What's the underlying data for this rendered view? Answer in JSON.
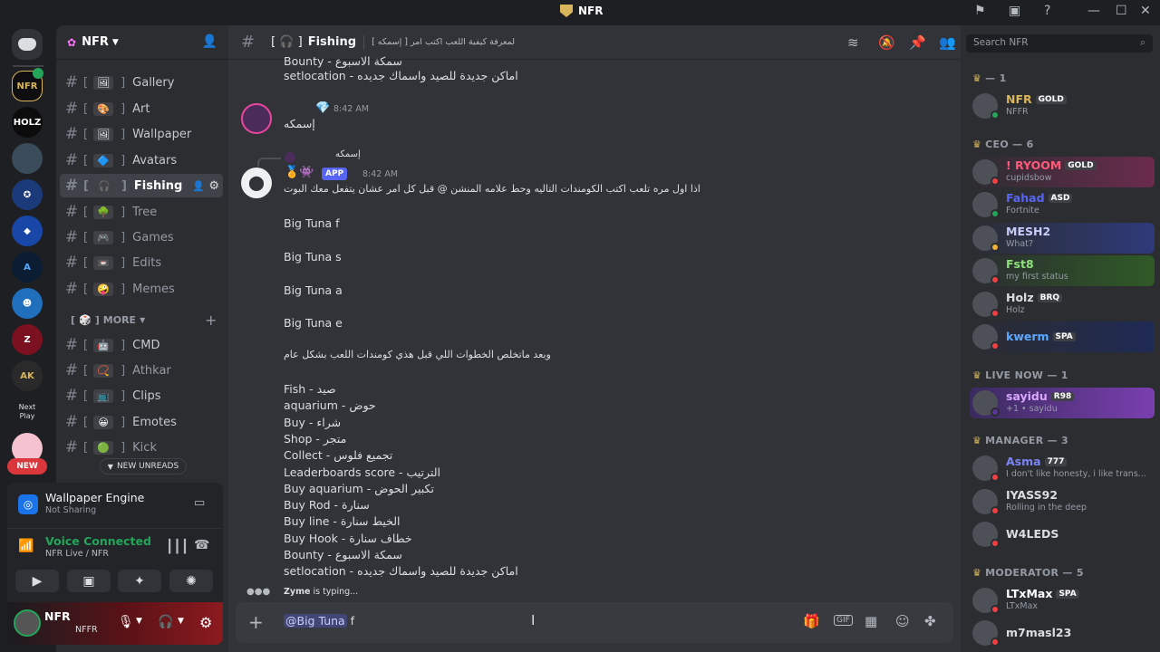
{
  "window": {
    "title": "NFR"
  },
  "servers": [
    {
      "name": "HOLZ",
      "color": "#0c0c0c"
    },
    {
      "name": "NEW",
      "color": "#da373c"
    },
    {
      "name": "Next Play",
      "color": "#1e1f22"
    }
  ],
  "sidebar": {
    "server_name": "NFR",
    "channels": [
      {
        "emoji": "🖼",
        "label": "Gallery",
        "bg": "#3f4147"
      },
      {
        "emoji": "🎨",
        "label": "Art",
        "bg": "#3f4147"
      },
      {
        "emoji": "🖼",
        "label": "Wallpaper",
        "bg": "#3f4147"
      },
      {
        "emoji": "🔷",
        "label": "Avatars",
        "bg": "#3f4147"
      },
      {
        "emoji": "🎧",
        "label": "Fishing",
        "bg": "#3f4147"
      },
      {
        "emoji": "🌳",
        "label": "Tree",
        "bg": "#3f4147"
      },
      {
        "emoji": "🎮",
        "label": "Games",
        "bg": "#3f4147"
      },
      {
        "emoji": "📼",
        "label": "Edits",
        "bg": "#3f4147"
      },
      {
        "emoji": "🤪",
        "label": "Memes",
        "bg": "#3f4147"
      }
    ],
    "more_label": "MORE",
    "more_channels": [
      {
        "emoji": "🤖",
        "label": "CMD"
      },
      {
        "emoji": "📿",
        "label": "Athkar"
      },
      {
        "emoji": "📺",
        "label": "Clips"
      },
      {
        "emoji": "😀",
        "label": "Emotes"
      },
      {
        "emoji": "🟢",
        "label": "Kick"
      }
    ],
    "new_unreads": "NEW UNREADS",
    "wallpaper": {
      "title": "Wallpaper Engine",
      "status": "Not Sharing"
    },
    "voice": {
      "title": "Voice Connected",
      "channel": "NFR Live / NFR"
    },
    "user": {
      "name": "NFR",
      "tag": "NFFR"
    }
  },
  "chat": {
    "channel_name": "Fishing",
    "channel_prefix": "[ 🎧 ]",
    "topic": "لمعرفة كيفية اللعب اكتب امر [ إسمكه ]",
    "search_placeholder": "Search NFR",
    "top_lines": [
      "Bounty - سمكة الاسبوع",
      "setlocation - اماكن جديدة للصيد واسماك جديده"
    ],
    "msg1": {
      "time": "8:42 AM",
      "text": "إسمكه"
    },
    "reply_name": "إسمكه",
    "msg2": {
      "badge": "APP",
      "time": "8:42 AM",
      "intro": "اذا اول مره تلعب اكتب الكومندات التاليه وحط علامه  المنشن @ قبل كل  امر  عشان يتفعل معك البوت",
      "tuna": [
        "Big Tuna f",
        "Big Tuna s",
        "Big Tuna a",
        "Big Tuna e"
      ],
      "after": "وبعد ماتخلص الخطوات اللي قبل هذي كومندات اللعب بشكل عام",
      "commands": [
        "Fish - صيد",
        "aquarium - حوض",
        "Buy - شراء",
        "Shop - متجر",
        "Collect - تجميع فلوس",
        "Leaderboards score - الترتيب",
        "Buy aquarium - تكبير الحوض",
        "Buy Rod - سنارة",
        "Buy line - الخيط سنارة",
        "Buy Hook - خطاف سنارة",
        "Bounty - سمكة الاسبوع",
        "setlocation - اماكن جديدة للصيد واسماك جديده"
      ]
    },
    "typing": {
      "user": "Zyme",
      "text": "is typing..."
    },
    "composer": {
      "mention": "@Big Tuna",
      "text": " f"
    }
  },
  "members": {
    "groups": [
      {
        "label": "— 1",
        "items": [
          {
            "name": "NFR",
            "tag": "GOLD",
            "sub": "NFFR",
            "color": "#d9b55b",
            "status": "#23a55a",
            "bg": ""
          }
        ]
      },
      {
        "label": "CEO — 6",
        "items": [
          {
            "name": "! RYOOM",
            "tag": "GOLD",
            "sub": "cupidsbow",
            "color": "#ff5a7a",
            "status": "#f23f43",
            "bg": "linear-gradient(90deg,#2b2d31,#6b2b4d)"
          },
          {
            "name": "Fahad",
            "tag": "ASD",
            "sub": "Fortnite",
            "color": "#5865f2",
            "status": "#23a55a",
            "bg": ""
          },
          {
            "name": "MESH2",
            "tag": "",
            "sub": "What?",
            "color": "#c9cdfb",
            "status": "#f0b232",
            "bg": "linear-gradient(90deg,#2b2d31,#2e3a7a)"
          },
          {
            "name": "Fst8",
            "tag": "",
            "sub": "my first status",
            "color": "#8ee07a",
            "status": "#f23f43",
            "bg": "linear-gradient(90deg,#2b2d31,#2f5a26)"
          },
          {
            "name": "Holz",
            "tag": "BRQ",
            "sub": "Holz",
            "color": "#dbdee1",
            "status": "#f23f43",
            "bg": ""
          },
          {
            "name": "kwerm",
            "tag": "SPA",
            "sub": "",
            "color": "#5aa8ff",
            "status": "#f23f43",
            "bg": "linear-gradient(90deg,#2b2d31,#1f2a55)"
          }
        ]
      },
      {
        "label": "LIVE NOW — 1",
        "items": [
          {
            "name": "sayidu",
            "tag": "R98",
            "sub": "+1 • sayidu",
            "color": "#d9a6ff",
            "status": "#593695",
            "bg": "linear-gradient(90deg,#3a2a5e,#7a3fb0)"
          }
        ]
      },
      {
        "label": "MANAGER — 3",
        "items": [
          {
            "name": "Asma",
            "tag": "777",
            "sub": "I don't like honesty, i like trans...",
            "color": "#7b84f5",
            "status": "#f23f43",
            "bg": ""
          },
          {
            "name": "IYASS92",
            "tag": "",
            "sub": "Rolling in the deep",
            "color": "#dbdee1",
            "status": "#f23f43",
            "bg": ""
          },
          {
            "name": "W4LEDS",
            "tag": "",
            "sub": "",
            "color": "#dbdee1",
            "status": "#f23f43",
            "bg": ""
          }
        ]
      },
      {
        "label": "MODERATOR — 5",
        "items": [
          {
            "name": "LTxMax",
            "tag": "SPA",
            "sub": "LTxMax",
            "color": "#ffffff",
            "status": "#f23f43",
            "bg": ""
          },
          {
            "name": "m7masl23",
            "tag": "",
            "sub": "",
            "color": "#dbdee1",
            "status": "#f23f43",
            "bg": ""
          }
        ]
      }
    ]
  }
}
